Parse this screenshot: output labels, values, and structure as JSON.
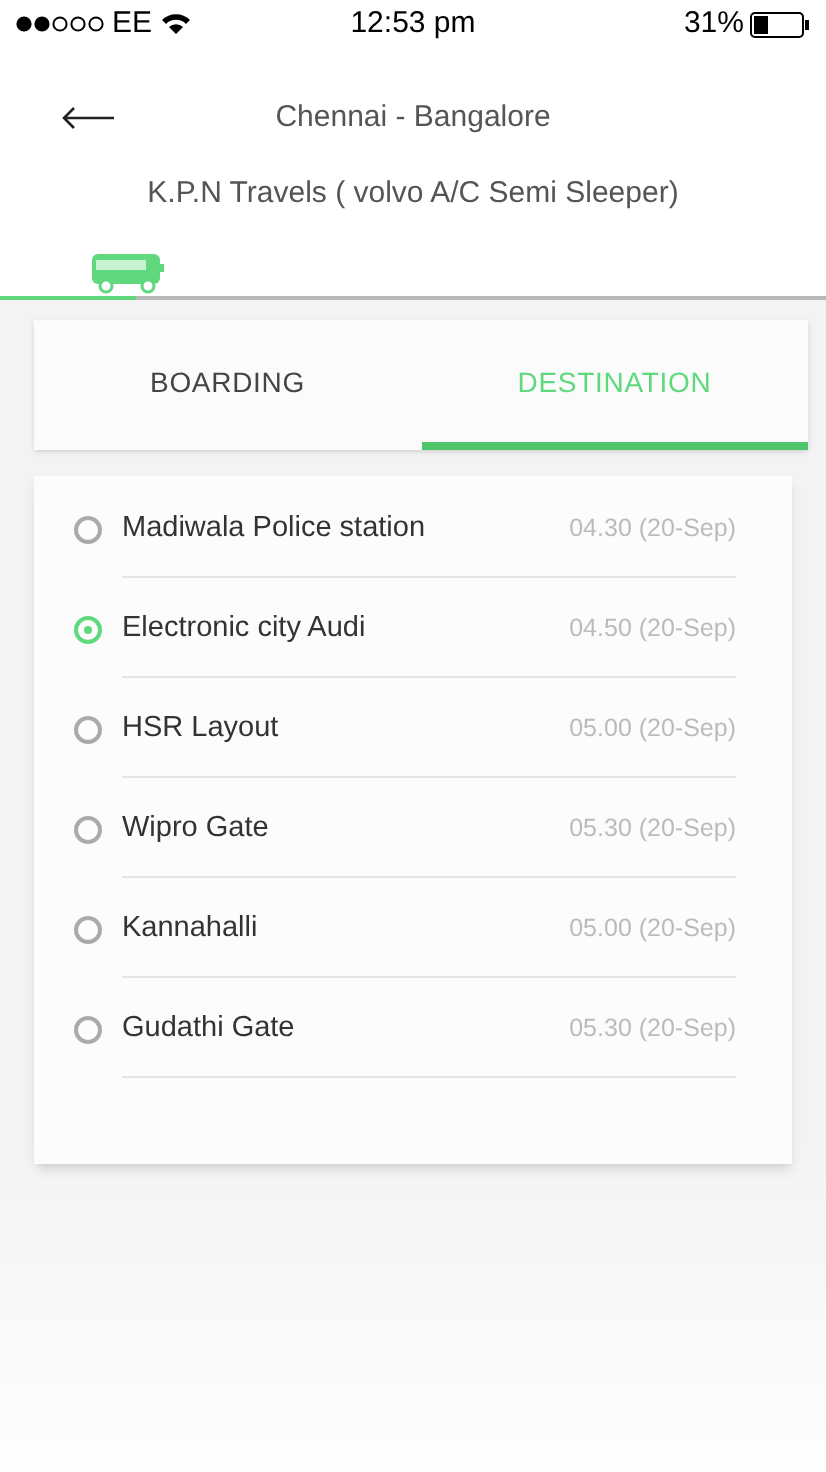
{
  "status_bar": {
    "carrier": "EE",
    "time": "12:53 pm",
    "battery": "31%"
  },
  "header": {
    "title": "Chennai - Bangalore",
    "subtitle": "K.P.N Travels ( volvo A/C Semi Sleeper)"
  },
  "progress": {
    "level": 0.165
  },
  "tabs": [
    {
      "label": "BOARDING",
      "selected": false
    },
    {
      "label": "DESTINATION",
      "selected": true
    }
  ],
  "stops": [
    {
      "name": "Madiwala Police station",
      "time": "04.30 (20-Sep)",
      "selected": false
    },
    {
      "name": "Electronic city Audi",
      "time": "04.50 (20-Sep)",
      "selected": true
    },
    {
      "name": "HSR Layout",
      "time": "05.00 (20-Sep)",
      "selected": false
    },
    {
      "name": "Wipro Gate",
      "time": "05.30 (20-Sep)",
      "selected": false
    },
    {
      "name": "Kannahalli",
      "time": "05.00 (20-Sep)",
      "selected": false
    },
    {
      "name": "Gudathi Gate",
      "time": "05.30 (20-Sep)",
      "selected": false
    }
  ]
}
